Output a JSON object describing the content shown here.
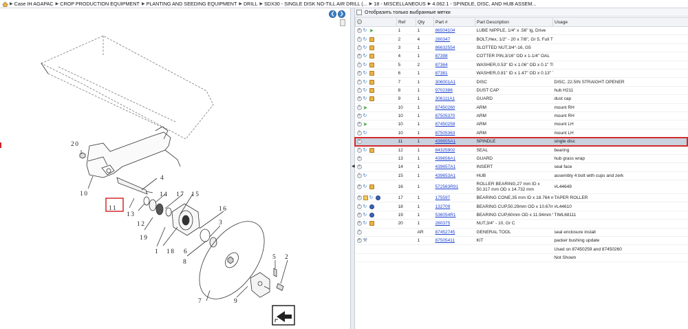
{
  "breadcrumb": [
    "Case IH AGAPAC",
    "CROP PRODUCTION EQUIPMENT",
    "PLANTING AND SEEDING EQUIPMENT",
    "DRILL",
    "SDX30 - SINGLE DISK NO-TILL AIR DRILL (...",
    "18 - MISCELLANEOUS",
    "4.062.1 - SPINDLE, DISC, AND HUB ASSEM..."
  ],
  "diagram": {
    "callouts": [
      "20",
      "10",
      "11",
      "4",
      "14",
      "17",
      "15",
      "16",
      "12",
      "13",
      "19",
      "1",
      "18",
      "6",
      "3",
      "8",
      "5",
      "2",
      "7",
      "9"
    ],
    "highlighted_callout": "11"
  },
  "filter": {
    "label": "Отобразить только выбранные метки",
    "checked": false
  },
  "table": {
    "headers": [
      "",
      "Ref",
      "Qty",
      "Part #",
      "Part Description",
      "Usage"
    ],
    "rows": [
      {
        "icons": [
          "add",
          "cycle",
          "green"
        ],
        "ref": "1",
        "qty": "1",
        "part": "86504104",
        "desc": "LUBE NIPPLE, 1/4\" x .56\" lg, Drive",
        "usage": ""
      },
      {
        "icons": [
          "add",
          "cycle",
          "box"
        ],
        "ref": "2",
        "qty": "4",
        "part": "280347",
        "desc": "BOLT,Hex, 1/2\" - 20 x 7/8\", Gr 5, Full Thd",
        "usage": ""
      },
      {
        "icons": [
          "add",
          "cycle",
          "box"
        ],
        "ref": "3",
        "qty": "1",
        "part": "86632554",
        "desc": "SLOTTED NUT,3/4\"-16, G5",
        "usage": ""
      },
      {
        "icons": [
          "add",
          "cycle",
          "box"
        ],
        "ref": "4",
        "qty": "1",
        "part": "87398",
        "desc": "COTTER PIN,3/16\" OD x 1-1/4\" OAL",
        "usage": ""
      },
      {
        "icons": [
          "add",
          "cycle",
          "box"
        ],
        "ref": "5",
        "qty": "2",
        "part": "87364",
        "desc": "WASHER,0.53\" ID x 1.06\" OD x 0.1\" Thk",
        "usage": ""
      },
      {
        "icons": [
          "add",
          "cycle",
          "box"
        ],
        "ref": "6",
        "qty": "1",
        "part": "87381",
        "desc": "WASHER,0.81\" ID x 1.47\" OD x 0.13\" Thk",
        "usage": ""
      },
      {
        "icons": [
          "add",
          "cycle",
          "box"
        ],
        "ref": "7",
        "qty": "1",
        "part": "306001A1",
        "desc": "DISC",
        "usage": "DISC, 22.5IN STRAIGHT OPENER"
      },
      {
        "icons": [
          "add",
          "cycle",
          "box"
        ],
        "ref": "8",
        "qty": "1",
        "part": "9702386",
        "desc": "DUST CAP",
        "usage": "hub H211"
      },
      {
        "icons": [
          "add",
          "cycle",
          "box"
        ],
        "ref": "9",
        "qty": "1",
        "part": "306111A1",
        "desc": "GUARD",
        "usage": "dust cap"
      },
      {
        "icons": [
          "add",
          "green"
        ],
        "ref": "10",
        "qty": "1",
        "part": "87450260",
        "desc": "ARM",
        "usage": "mount RH"
      },
      {
        "icons": [
          "add",
          "cycle"
        ],
        "ref": "10",
        "qty": "1",
        "part": "87505370",
        "desc": "ARM",
        "usage": "mount RH"
      },
      {
        "icons": [
          "add",
          "green"
        ],
        "ref": "10",
        "qty": "1",
        "part": "87450259",
        "desc": "ARM",
        "usage": "mount LH"
      },
      {
        "icons": [
          "add",
          "cycle"
        ],
        "ref": "10",
        "qty": "1",
        "part": "87505363",
        "desc": "ARM",
        "usage": "mount LH"
      },
      {
        "icons": [
          "add"
        ],
        "ref": "11",
        "qty": "1",
        "part": "439655A1",
        "desc": "SPINDLE",
        "usage": "single disc",
        "selected": true
      },
      {
        "icons": [
          "add",
          "cycle",
          "box"
        ],
        "ref": "12",
        "qty": "1",
        "part": "84325902",
        "desc": "SEAL",
        "usage": "bearing"
      },
      {
        "icons": [
          "add"
        ],
        "ref": "13",
        "qty": "1",
        "part": "439656A1",
        "desc": "GUARD",
        "usage": "hub grass wrap"
      },
      {
        "icons": [
          "add"
        ],
        "ref": "14",
        "qty": "1",
        "part": "439657A1",
        "desc": "INSERT",
        "usage": "seal face"
      },
      {
        "icons": [
          "add",
          "cycle"
        ],
        "ref": "15",
        "qty": "1",
        "part": "439653A1",
        "desc": "HUB",
        "usage": "assembly 4 bolt with cups and zerk"
      },
      {
        "icons": [
          "add",
          "cycle",
          "box"
        ],
        "ref": "16",
        "qty": "1",
        "part": "572563R91",
        "desc": "ROLLER BEARING,27 mm ID x 50.317 mm OD x 14.732 mm",
        "usage": "#L44649",
        "two_line": true
      },
      {
        "icons": [
          "add",
          "folder",
          "cycle",
          "blue"
        ],
        "ref": "17",
        "qty": "1",
        "part": "175597",
        "desc": "BEARING CONE,35 mm ID x 18.764 mm",
        "usage": "TAPER ROLLER"
      },
      {
        "icons": [
          "add",
          "cycle",
          "blue"
        ],
        "ref": "18",
        "qty": "1",
        "part": "132709",
        "desc": "BEARING CUP,50.29mm OD x 10.67mm W",
        "usage": "#L44610"
      },
      {
        "icons": [
          "add",
          "cycle",
          "blue"
        ],
        "ref": "19",
        "qty": "1",
        "part": "536054R1",
        "desc": "BEARING CUP,60mm OD x 11.94mm W",
        "usage": "TIML68111"
      },
      {
        "icons": [
          "add",
          "cycle",
          "box"
        ],
        "ref": "20",
        "qty": "1",
        "part": "280375",
        "desc": "NUT,3/4\" - 10, Gr C",
        "usage": ""
      },
      {
        "icons": [
          "add"
        ],
        "ref": "",
        "qty": "AR",
        "part": "87452745",
        "desc": "GENERAL TOOL",
        "usage": "seal enclosure install"
      },
      {
        "icons": [
          "add",
          "wrench"
        ],
        "ref": "",
        "qty": "1",
        "part": "87505411",
        "desc": "KIT",
        "usage": "packer bushing update"
      },
      {
        "icons": [],
        "ref": "",
        "qty": "",
        "part": "",
        "desc": "",
        "usage": "Used on 87450259 and 87450260"
      },
      {
        "icons": [],
        "ref": "",
        "qty": "",
        "part": "",
        "desc": "",
        "usage": "Not Shown"
      }
    ]
  },
  "colors": {
    "link": "#1a3fd0",
    "selection_outline": "#d22a2a",
    "selected_row": "#c9d2de",
    "nav_button": "#3a7fc6"
  }
}
